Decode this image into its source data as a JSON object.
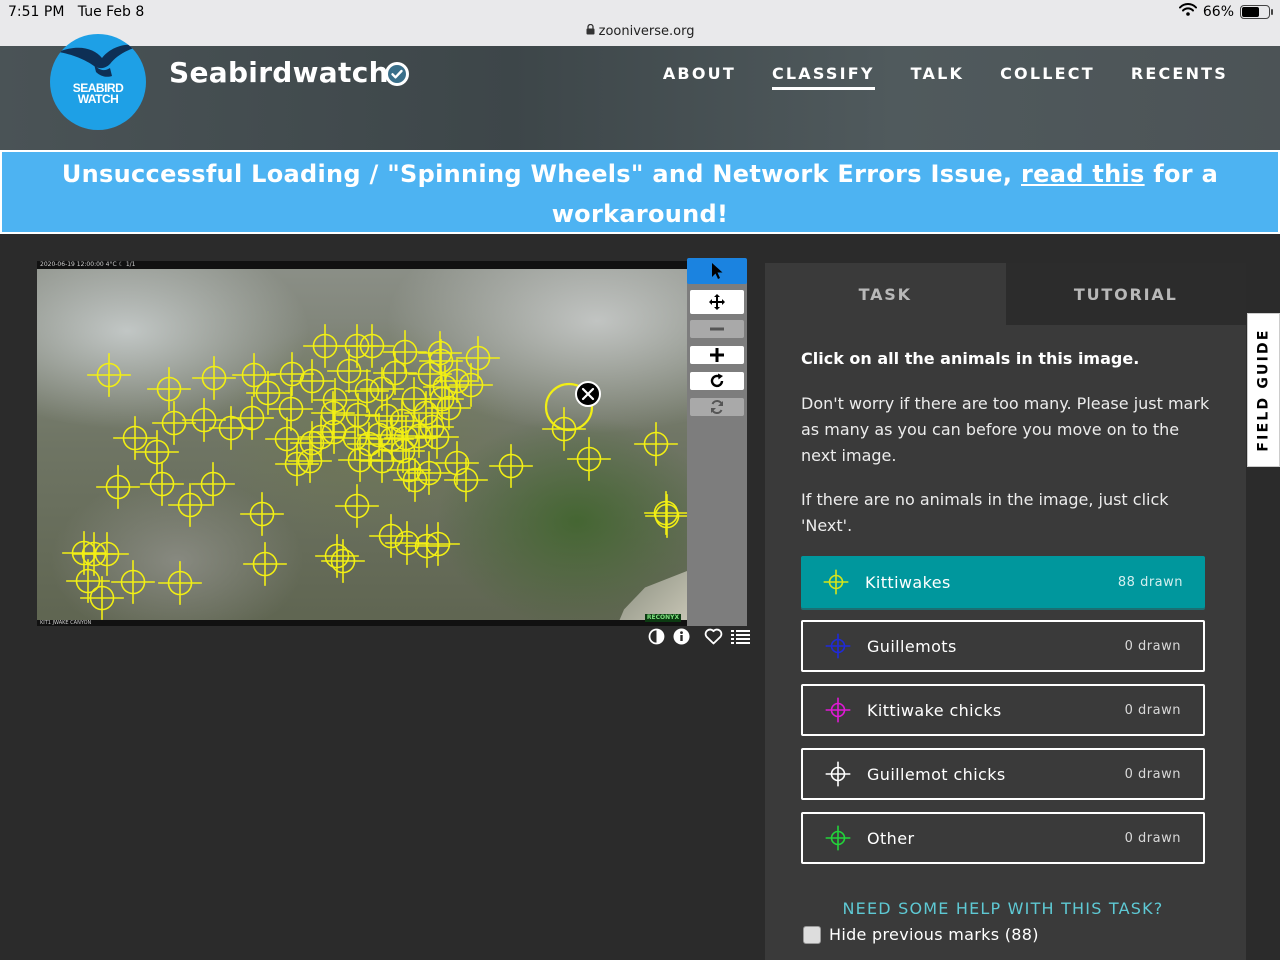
{
  "status_bar": {
    "time": "7:51 PM",
    "date": "Tue Feb 8",
    "url": "zooniverse.org",
    "battery": "66%",
    "battery_level": 0.66
  },
  "project": {
    "logo_line1": "SEABIRD",
    "logo_line2": "WATCH",
    "title": "Seabirdwatch"
  },
  "nav": {
    "about": "ABOUT",
    "classify": "CLASSIFY",
    "talk": "TALK",
    "collect": "COLLECT",
    "recents": "RECENTS"
  },
  "banner": {
    "text_before": "Unsuccessful Loading / \"Spinning Wheels\" and Network Errors Issue, ",
    "link": "read this",
    "text_after": " for a workaround!"
  },
  "subject": {
    "timestamp": "2020-06-19 12:00:00    4°C   ☾   1/1",
    "camera_label": "KIT1 JWAKE CANYON",
    "brand": "RECONYX",
    "mark_color": "#f2ef14"
  },
  "task_panel": {
    "tab_task": "TASK",
    "tab_tutorial": "TUTORIAL",
    "instruction": "Click on all the animals in this image.",
    "help_1": "Don't worry if there are too many. Please just mark as many as you can before you move on to the next image.",
    "help_2": "If there are no animals in the image, just click 'Next'.",
    "answers": [
      {
        "label": "Kittiwakes",
        "count": "88 drawn",
        "color": "#d6e51a"
      },
      {
        "label": "Guillemots",
        "count": "0 drawn",
        "color": "#1f2ad9"
      },
      {
        "label": "Kittiwake chicks",
        "count": "0 drawn",
        "color": "#e019d6"
      },
      {
        "label": "Guillemot chicks",
        "count": "0 drawn",
        "color": "#ffffff"
      },
      {
        "label": "Other",
        "count": "0 drawn",
        "color": "#22d43a"
      }
    ],
    "need_help": "NEED SOME HELP WITH THIS TASK?",
    "hide_marks": "Hide previous marks (88)"
  },
  "field_guide": "FIELD GUIDE",
  "colors": {
    "accent_teal": "#00979d",
    "banner_blue": "#4db3f2",
    "logo_blue": "#1ea0e6"
  }
}
